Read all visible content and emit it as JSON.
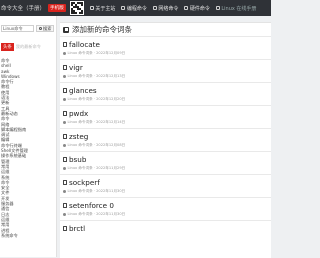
{
  "topbar": {
    "site_title": "命令大全（手册）",
    "red_badge": "手机版",
    "nav": [
      {
        "label": "关于主站",
        "icon": "home-icon"
      },
      {
        "label": "编程命令",
        "icon": "book-icon"
      },
      {
        "label": "网络命令",
        "icon": "globe-icon"
      },
      {
        "label": "硬件命令",
        "icon": "chip-icon"
      },
      {
        "label": "Linux 在线手册",
        "icon": "terminal-icon"
      }
    ]
  },
  "sidebar": {
    "search_value": "Linux命令",
    "search_button": "搜索",
    "tag_label": "头条",
    "tag_hint": "我的最新命令",
    "categories": [
      "命令",
      "shell",
      "awk",
      "Windows",
      "命令行",
      "教程",
      "使用",
      "语法",
      "更新",
      "工具",
      "最新动态",
      "命令",
      "网络",
      "脚本编程指南",
      "调试",
      "编辑",
      "命令行终端",
      "Shell文件管理",
      "操作系统基础",
      "管理",
      "常用",
      "运维",
      "系统",
      "命令",
      "安全",
      "文件",
      "开发",
      "服务器",
      "通信",
      "日志",
      "运维",
      "常用",
      "进程",
      "系统命令"
    ]
  },
  "main": {
    "title": "添加新的命令词条",
    "items": [
      {
        "name": "fallocate",
        "meta": "Linux 命令词条 · 2022年12月09日"
      },
      {
        "name": "vigr",
        "meta": "Linux 命令词条 · 2022年12月13日"
      },
      {
        "name": "glances",
        "meta": "Linux 命令词条 · 2022年12月20日"
      },
      {
        "name": "pwdx",
        "meta": "Linux 命令词条 · 2022年12月14日"
      },
      {
        "name": "zsteg",
        "meta": "Linux 命令词条 · 2022年12月08日"
      },
      {
        "name": "bsub",
        "meta": "Linux 命令词条 · 2022年11月29日"
      },
      {
        "name": "sockperf",
        "meta": "Linux 命令词条 · 2022年11月30日"
      },
      {
        "name": "setenforce 0",
        "meta": "Linux 命令词条 · 2022年11月30日"
      },
      {
        "name": "brctl",
        "meta": ""
      }
    ]
  }
}
